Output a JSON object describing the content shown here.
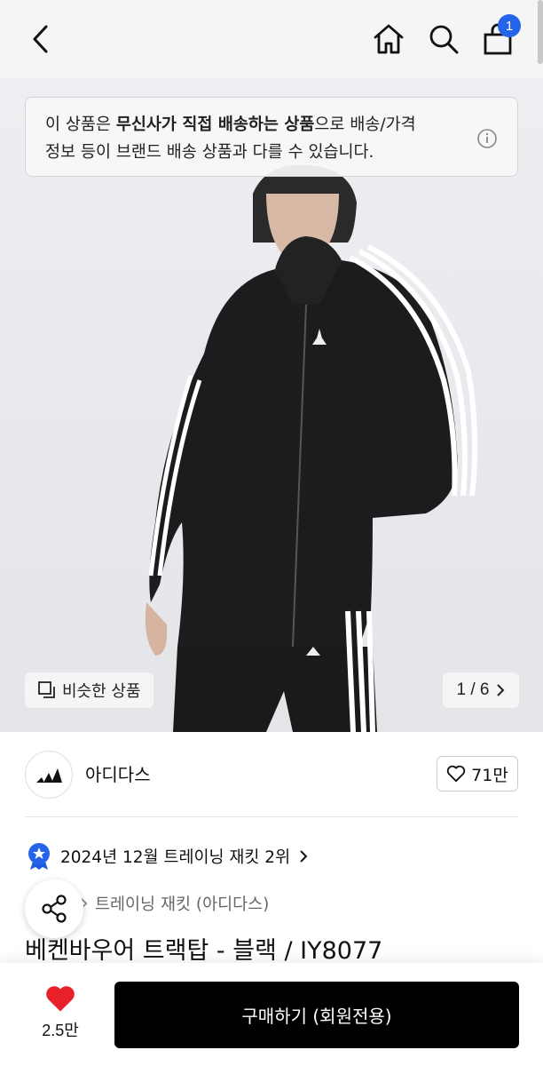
{
  "header": {
    "cart_count": "1",
    "back_icon": "chevron-left-icon",
    "home_icon": "home-icon",
    "search_icon": "search-icon",
    "cart_icon": "shopping-bag-icon"
  },
  "notice": {
    "text_pre": "이 상품은 ",
    "text_bold": "무신사가 직접 배송하는 상품",
    "text_post_line1": "으로 배송/가격",
    "text_line2": "정보 등이 브랜드 배송 상품과 다를 수 있습니다."
  },
  "gallery": {
    "similar_label": "비슷한 상품",
    "counter": "1 / 6"
  },
  "brand": {
    "name": "아디다스",
    "likes": "71만"
  },
  "ranking": {
    "text": "2024년 12월 트레이닝 재킷 2위"
  },
  "breadcrumb": {
    "category": "트레이닝 재킷 (아디다스)"
  },
  "product": {
    "title": "베켄바우어 트랙탑 - 블랙 / IY8077"
  },
  "bottom_bar": {
    "fav_count": "2.5만",
    "buy_label": "구매하기 (회원전용)"
  },
  "colors": {
    "badge": "#2563eb",
    "heart": "#e8202a",
    "buy_button": "#000000"
  }
}
